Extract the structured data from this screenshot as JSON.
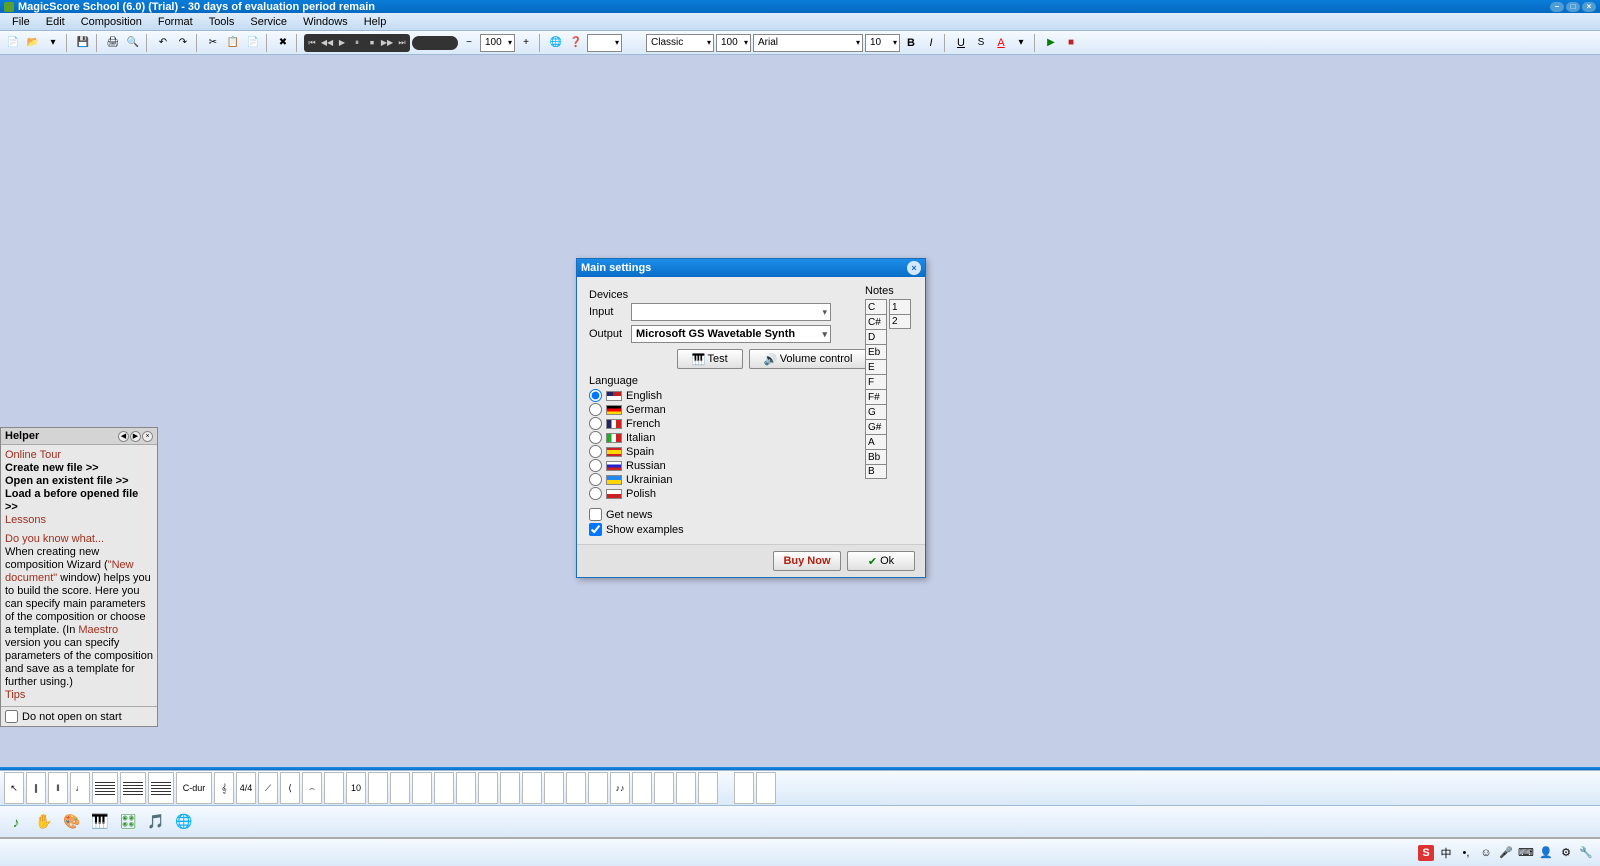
{
  "title": "MagicScore School (6.0) (Trial) - 30 days of evaluation period remain",
  "menu": [
    "File",
    "Edit",
    "Composition",
    "Format",
    "Tools",
    "Service",
    "Windows",
    "Help"
  ],
  "toolbar": {
    "tempo_value": "100",
    "style_value": "Classic",
    "zoom_value": "100",
    "font_value": "Arial",
    "fontsize_value": "10"
  },
  "helper": {
    "title": "Helper",
    "online_tour": "Online Tour",
    "create": "Create new file >>",
    "open_existent": "Open an existent file >>",
    "load_before": "Load a before opened file >>",
    "lessons": "Lessons",
    "dyk": "Do you know what...",
    "body1": "When creating new composition Wizard (",
    "body1_link": "\"New document\"",
    "body2": " window) helps you to build the score. Here you can specify main parameters of the composition or choose a template. (In ",
    "body2_link": "Maestro",
    "body3": " version you can specify parameters of the composition and save as a template for further using.)",
    "tips": "Tips",
    "no_open": "Do not open on start"
  },
  "dialog": {
    "title": "Main settings",
    "devices": "Devices",
    "input_lbl": "Input",
    "input_val": "",
    "output_lbl": "Output",
    "output_val": "Microsoft GS Wavetable Synth",
    "test": "Test",
    "volume": "Volume control",
    "language": "Language",
    "langs": [
      "English",
      "German",
      "French",
      "Italian",
      "Spain",
      "Russian",
      "Ukrainian",
      "Polish"
    ],
    "lang_selected": "English",
    "get_news": "Get news",
    "show_examples": "Show examples",
    "notes_lbl": "Notes",
    "notes": [
      "C",
      "C#",
      "D",
      "Eb",
      "E",
      "F",
      "F#",
      "G",
      "G#",
      "A",
      "Bb",
      "B"
    ],
    "note_nums": [
      "1",
      "2"
    ],
    "buy": "Buy Now",
    "ok": "Ok"
  },
  "bottom_key": "C-dur",
  "bottom_num": "10",
  "taskbar_cn": "中"
}
